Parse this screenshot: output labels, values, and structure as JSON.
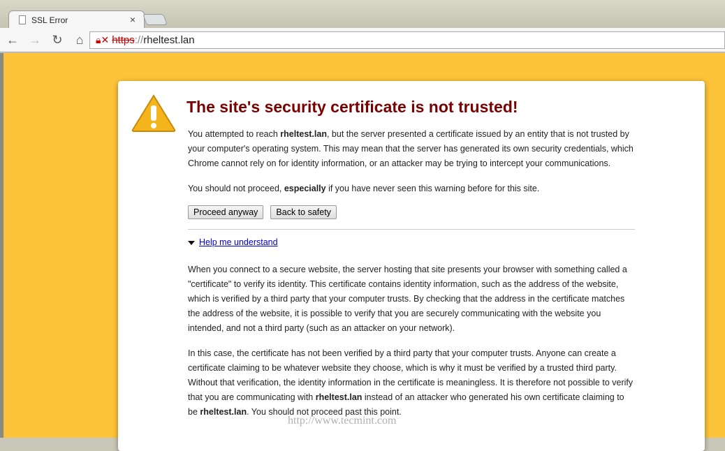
{
  "tab": {
    "title": "SSL Error",
    "close": "×"
  },
  "nav": {
    "back": "←",
    "forward": "→",
    "reload": "↻",
    "home": "⌂"
  },
  "omnibox": {
    "scheme": "https",
    "sep": "://",
    "host": "rheltest.lan"
  },
  "card": {
    "title": "The site's security certificate is not trusted!",
    "p1": [
      "You attempted to reach ",
      "rheltest.lan",
      ", but the server presented a certificate issued by an entity that is not trusted by your computer's operating system. This may mean that the server has generated its own security credentials, which Chrome cannot rely on for identity information, or an attacker may be trying to intercept your communications."
    ],
    "p2": [
      "You should not proceed, ",
      "especially",
      " if you have never seen this warning before for this site."
    ],
    "proceed": "Proceed anyway",
    "back": "Back to safety",
    "help": "Help me understand",
    "p3": "When you connect to a secure website, the server hosting that site presents your browser with something called a \"certificate\" to verify its identity. This certificate contains identity information, such as the address of the website, which is verified by a third party that your computer trusts. By checking that the address in the certificate matches the address of the website, it is possible to verify that you are securely communicating with the website you intended, and not a third party (such as an attacker on your network).",
    "p4": [
      "In this case, the certificate has not been verified by a third party that your computer trusts. Anyone can create a certificate claiming to be whatever website they choose, which is why it must be verified by a trusted third party. Without that verification, the identity information in the certificate is meaningless. It is therefore not possible to verify that you are communicating with ",
      "rheltest.lan",
      " instead of an attacker who generated his own certificate claiming to be ",
      "rheltest.lan",
      ". You should not proceed past this point."
    ]
  },
  "watermark": "http://www.tecmint.com"
}
